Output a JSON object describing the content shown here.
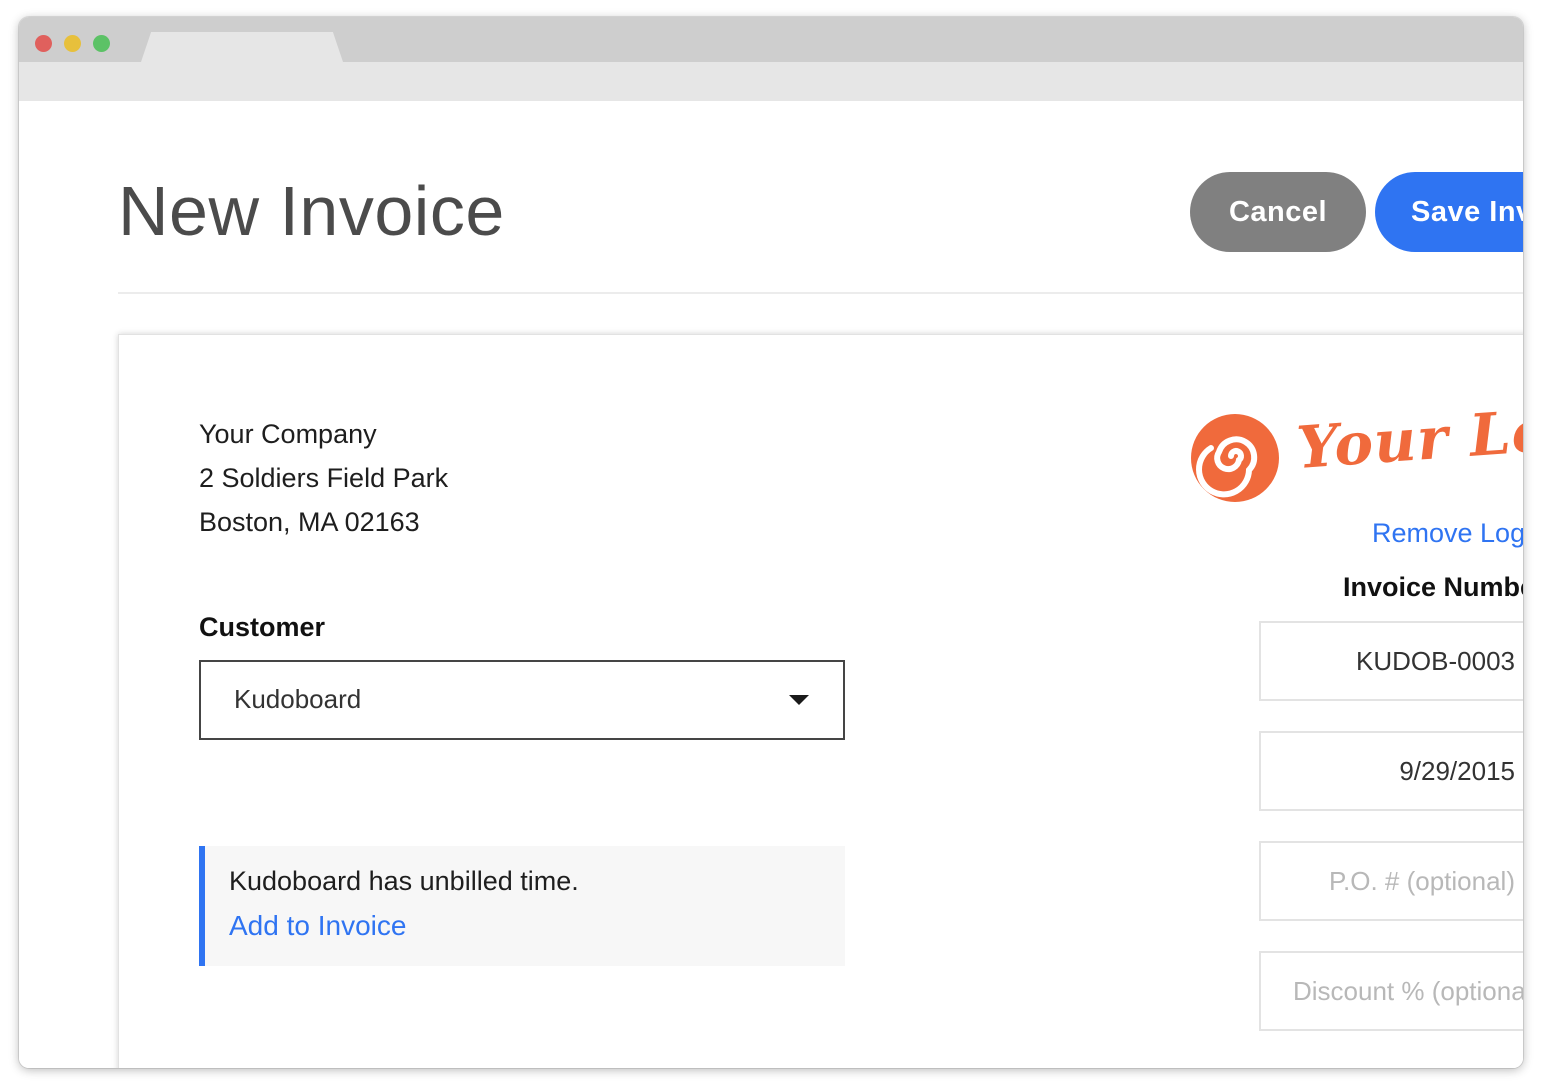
{
  "page": {
    "title": "New Invoice",
    "cancel_label": "Cancel",
    "save_label": "Save Invoice"
  },
  "company": {
    "name": "Your Company",
    "street": "2 Soldiers Field Park",
    "city_line": "Boston, MA 02163"
  },
  "customer": {
    "label": "Customer",
    "selected": "Kudoboard"
  },
  "notice": {
    "message": "Kudoboard has unbilled time.",
    "action": "Add to Invoice"
  },
  "logo": {
    "text": "Your Logo",
    "remove_label": "Remove Logo",
    "color": "#f06a3c"
  },
  "invoice": {
    "number_label": "Invoice Number",
    "number_value": "KUDOB-0003",
    "date_value": "9/29/2015",
    "po_placeholder": "P.O. # (optional)",
    "discount_placeholder": "Discount % (optional)"
  },
  "colors": {
    "accent": "#2f74f2",
    "cancel_bg": "#808080"
  }
}
